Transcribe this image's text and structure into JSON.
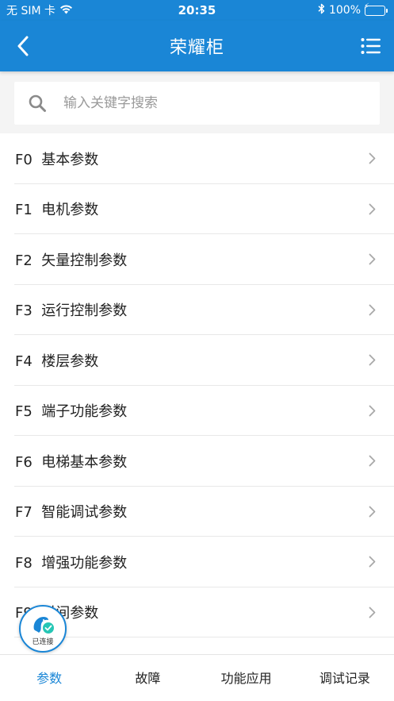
{
  "status_bar": {
    "carrier": "无 SIM 卡",
    "time": "20:35",
    "battery": "100%",
    "battery_level": 1.0
  },
  "nav": {
    "title": "荣耀柜"
  },
  "search": {
    "placeholder": "输入关键字搜索"
  },
  "list": {
    "items": [
      {
        "label": "F0  基本参数"
      },
      {
        "label": "F1  电机参数"
      },
      {
        "label": "F2  矢量控制参数"
      },
      {
        "label": "F3  运行控制参数"
      },
      {
        "label": "F4  楼层参数"
      },
      {
        "label": "F5  端子功能参数"
      },
      {
        "label": "F6  电梯基本参数"
      },
      {
        "label": "F7  智能调试参数"
      },
      {
        "label": "F8  增强功能参数"
      },
      {
        "label": "F9  时间参数"
      }
    ]
  },
  "connection": {
    "label": "已连接"
  },
  "tabs": [
    {
      "label": "参数",
      "active": true
    },
    {
      "label": "故障",
      "active": false
    },
    {
      "label": "功能应用",
      "active": false
    },
    {
      "label": "调试记录",
      "active": false
    }
  ],
  "colors": {
    "primary": "#1a86d6",
    "battery_fill": "#4cd964",
    "connection_check": "#26c6b5"
  }
}
